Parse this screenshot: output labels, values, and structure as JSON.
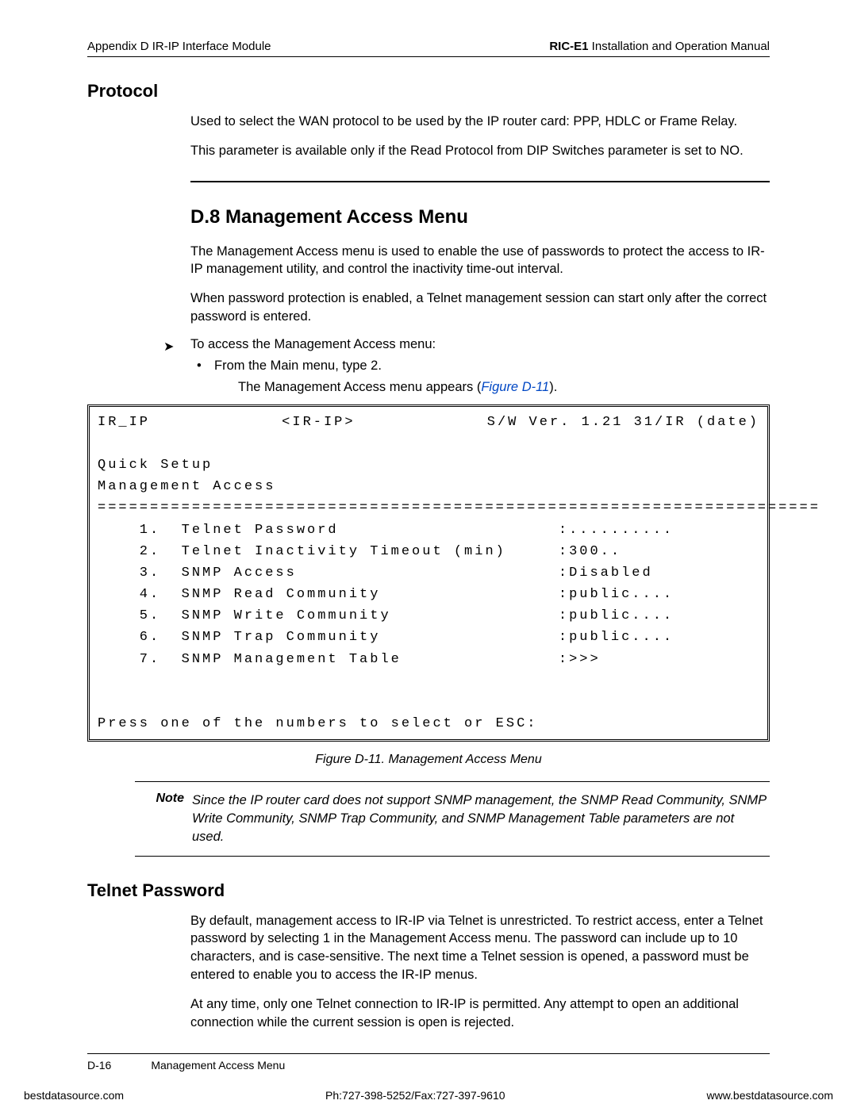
{
  "header": {
    "left": "Appendix D  IR-IP Interface Module",
    "right_bold": "RIC-E1",
    "right_rest": " Installation and Operation Manual"
  },
  "protocol": {
    "heading": "Protocol",
    "p1": "Used to select the WAN protocol to be used by the IP router card: PPP, HDLC or Frame Relay.",
    "p2": "This parameter is available only if the Read Protocol from DIP Switches parameter is set to NO."
  },
  "section": {
    "title": "D.8  Management Access Menu",
    "p1": "The Management Access menu is used to enable the use of passwords to protect the access to IR-IP management utility, and control the inactivity time-out interval.",
    "p2": "When password protection is enabled, a Telnet management session can start only after the correct password is entered.",
    "arrow": "To access the Management Access menu:",
    "bullet": "From the Main menu, type 2.",
    "sub_pre": "The Management Access menu appears (",
    "sub_link": "Figure D-11",
    "sub_post": ")."
  },
  "terminal": {
    "head_left": "IR_IP",
    "head_mid": "<IR-IP>",
    "head_right": "S/W Ver. 1.21 31/IR (date)",
    "line_blank": " ",
    "qs": "Quick Setup",
    "ma": "Management Access",
    "ruler": "=====================================================================",
    "items": [
      {
        "n": "1.",
        "label": "Telnet Password",
        "val": ":.........."
      },
      {
        "n": "2.",
        "label": "Telnet Inactivity Timeout (min)",
        "val": ":300.."
      },
      {
        "n": "3.",
        "label": "SNMP Access",
        "val": ":Disabled"
      },
      {
        "n": "4.",
        "label": "SNMP Read Community",
        "val": ":public...."
      },
      {
        "n": "5.",
        "label": "SNMP Write Community",
        "val": ":public...."
      },
      {
        "n": "6.",
        "label": "SNMP Trap Community",
        "val": ":public...."
      },
      {
        "n": "7.",
        "label": "SNMP Management Table",
        "val": ":>>>"
      }
    ],
    "prompt": "Press one of the numbers to select or ESC:"
  },
  "caption": "Figure D-11.  Management Access Menu",
  "note": {
    "label": "Note",
    "text": "Since the IP router card does not support SNMP management, the SNMP Read Community, SNMP Write Community, SNMP Trap Community, and SNMP Management Table parameters are not used."
  },
  "telnet": {
    "heading": "Telnet Password",
    "p1": "By default, management access to IR-IP via Telnet is unrestricted. To restrict access, enter a Telnet password by selecting 1 in the Management Access menu. The password can include up to 10 characters, and is case-sensitive. The next time a Telnet session is opened, a password must be entered to enable you to access the IR-IP menus.",
    "p2": "At any time, only one Telnet connection to IR-IP is permitted. Any attempt to open an additional connection while the current session is open is rejected."
  },
  "footer": {
    "page": "D-16",
    "name": "Management Access Menu"
  },
  "bottom": {
    "left": "bestdatasource.com",
    "mid": "Ph:727-398-5252/Fax:727-397-9610",
    "right": "www.bestdatasource.com"
  }
}
